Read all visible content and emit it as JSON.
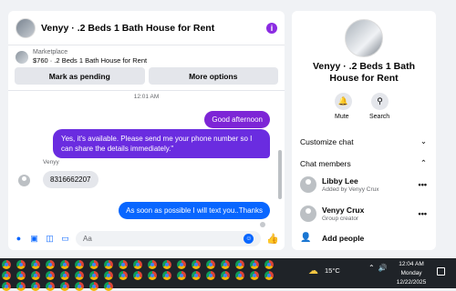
{
  "chat": {
    "title": "Venyy · .2 Beds 1 Bath House for Rent",
    "marketplace_label": "Marketplace",
    "listing": "$760 · .2 Beds 1 Bath House for Rent",
    "mark_pending": "Mark as pending",
    "more_options": "More options",
    "timestamp": "12:01 AM",
    "messages": [
      {
        "text": "Good afternoon",
        "from": "me"
      },
      {
        "text": "Yes, it's available. Please send me your phone number so I can share the details immediately.\"",
        "from": "me"
      },
      {
        "text": "8316662207",
        "from": "Venyy"
      },
      {
        "text": "As soon as possible I will text you..Thanks",
        "from": "me"
      }
    ],
    "sender_name": "Venyy",
    "input_placeholder": "Aa",
    "info_glyph": "i"
  },
  "sidebar": {
    "title": "Venyy · .2 Beds 1 Bath House for Rent",
    "mute_label": "Mute",
    "search_label": "Search",
    "customize_chat": "Customize chat",
    "chat_members": "Chat members",
    "members": [
      {
        "name": "Libby Lee",
        "sub": "Added by Venyy Crux"
      },
      {
        "name": "Venyy Crux",
        "sub": "Group creator"
      }
    ],
    "add_people": "Add people"
  },
  "taskbar": {
    "temperature": "15°C",
    "time": "12:04 AM",
    "day": "Monday",
    "date": "12/22/2025"
  },
  "colors": {
    "purple": "#7d25d6",
    "blue": "#0866ff"
  }
}
